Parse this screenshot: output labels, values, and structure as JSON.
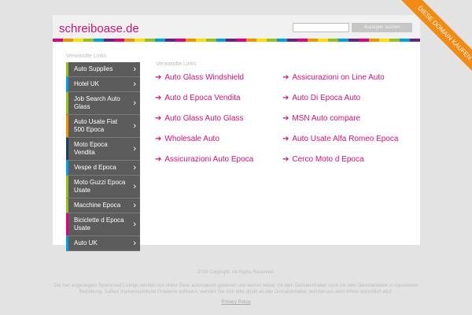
{
  "header": {
    "site_title": "schreiboase.de",
    "search_placeholder": "",
    "search_button": "Anzeigen suchen"
  },
  "rainbow_colors": [
    "#e6007e",
    "#f39200",
    "#ffde00",
    "#95c11f",
    "#009fe3",
    "#662483",
    "#e6007e",
    "#f39200",
    "#ffde00",
    "#95c11f",
    "#009fe3",
    "#662483",
    "#e6007e",
    "#f39200",
    "#ffde00",
    "#95c11f",
    "#009fe3",
    "#662483",
    "#e6007e",
    "#f39200",
    "#ffde00",
    "#95c11f",
    "#009fe3",
    "#662483",
    "#e6007e",
    "#f39200",
    "#ffde00",
    "#95c11f",
    "#009fe3",
    "#662483",
    "#e6007e",
    "#f39200",
    "#ffde00",
    "#95c11f",
    "#009fe3",
    "#662483"
  ],
  "sidebar": {
    "title": "Verwandte Links",
    "items": [
      {
        "label": "Auto Supplies",
        "color": "#95c11f"
      },
      {
        "label": "Hotel UK",
        "color": "#009fe3"
      },
      {
        "label": "Job Search Auto Glass",
        "color": "#95c11f"
      },
      {
        "label": "Auto Usate Fiat 500 Epoca",
        "color": "#f39200"
      },
      {
        "label": "Moto Epoca Vendita",
        "color": "#1d3f5e"
      },
      {
        "label": "Vespe d Epoca",
        "color": "#009fe3"
      },
      {
        "label": "Moto Guzzi Epoca Usate",
        "color": "#95c11f"
      },
      {
        "label": "Macchine Epoca",
        "color": "#95c11f"
      },
      {
        "label": "Biciclette d Epoca Usate",
        "color": "#e6007e"
      },
      {
        "label": "Auto UK",
        "color": "#009fe3"
      }
    ]
  },
  "main": {
    "title": "Verwandte Links",
    "arrow": "➔",
    "links": [
      "Auto Glass Windshield",
      "Assicurazioni on Line Auto",
      "Auto d Epoca Vendita",
      "Auto Di Epoca Auto",
      "Auto Glass Auto Glass",
      "MSN Auto compare",
      "Wholesale Auto",
      "Auto Usate Alfa Romeo Epoca",
      "Assicurazioni Auto Epoca",
      "Cerco Moto d Epoca"
    ]
  },
  "footer": {
    "copyright": "2018 Copyright. All Rights Reserved.",
    "disclaimer": "Die hier angezeigten Sponsored Listings werden von dritter Seite automatisch generiert und stehen weder mit dem Domaininhaber noch mit dem Dienstanbieter in irgendeiner Beziehung. Sollten markenrechtliche Probleme auftreten, wenden Sie sich bitte direkt an den Domaininhaber, welcher aus dem Whois ersichtlich wird.",
    "privacy": "Privacy Policy"
  },
  "banner": {
    "label": "DIESE DOMAIN KAUFEN.",
    "color": "#f28a16"
  }
}
